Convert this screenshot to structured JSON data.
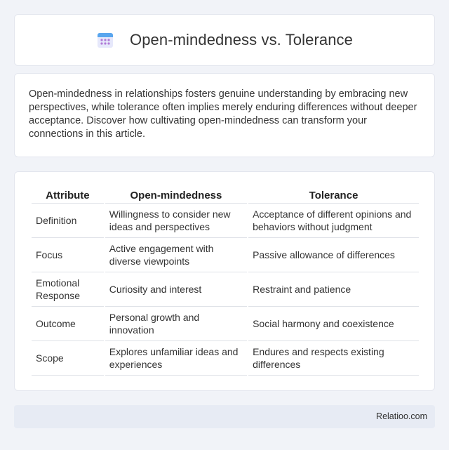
{
  "header": {
    "title": "Open-mindedness vs. Tolerance",
    "icon": "calendar-icon"
  },
  "intro": {
    "text": "Open-mindedness in relationships fosters genuine understanding by embracing new perspectives, while tolerance often implies merely enduring differences without deeper acceptance. Discover how cultivating open-mindedness can transform your connections in this article."
  },
  "table": {
    "headers": [
      "Attribute",
      "Open-mindedness",
      "Tolerance"
    ],
    "rows": [
      [
        "Definition",
        "Willingness to consider new ideas and perspectives",
        "Acceptance of different opinions and behaviors without judgment"
      ],
      [
        "Focus",
        "Active engagement with diverse viewpoints",
        "Passive allowance of differences"
      ],
      [
        "Emotional Response",
        "Curiosity and interest",
        "Restraint and patience"
      ],
      [
        "Outcome",
        "Personal growth and innovation",
        "Social harmony and coexistence"
      ],
      [
        "Scope",
        "Explores unfamiliar ideas and experiences",
        "Endures and respects existing differences"
      ]
    ]
  },
  "footer": {
    "brand": "Relatioo.com"
  }
}
